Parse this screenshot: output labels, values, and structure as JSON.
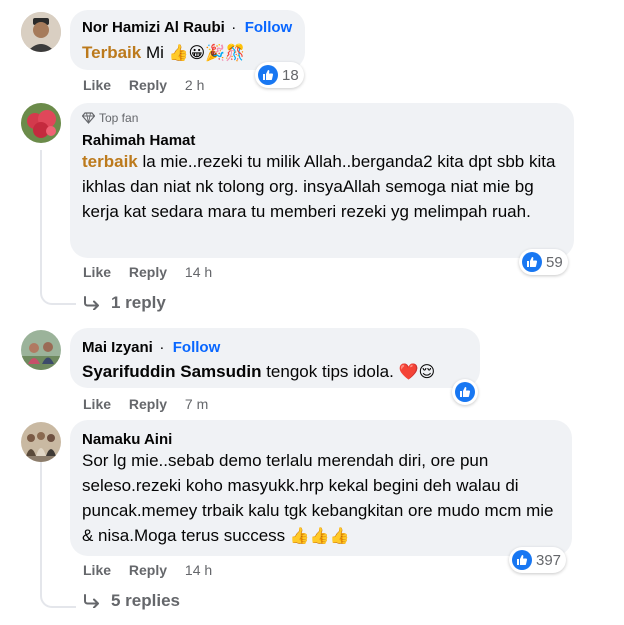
{
  "colors": {
    "follow": "#0866ff",
    "mention_gold": "#bc7a1c",
    "bubble": "#f0f2f5",
    "meta": "#65676b",
    "like_blue": "#1877f2"
  },
  "actions": {
    "like": "Like",
    "reply": "Reply",
    "follow": "Follow"
  },
  "comments": [
    {
      "author": "Nor Hamizi Al Raubi",
      "mention": "Terbaik",
      "text": " Mi ",
      "emojis": [
        "👍",
        "😀",
        "🎉",
        "🎊"
      ],
      "time": "2 h",
      "reactions": "18"
    },
    {
      "badge": "Top fan",
      "author": "Rahimah Hamat",
      "mention": "terbaik",
      "text": " la mie..rezeki tu milik Allah..berganda2 kita dpt sbb kita ikhlas dan niat nk tolong org. insyaAllah semoga niat mie bg kerja kat sedara mara tu memberi rezeki yg melimpah ruah.",
      "time": "14 h",
      "reactions": "59",
      "replies": "1 reply"
    },
    {
      "author": "Mai Izyani",
      "mention": "Syarifuddin Samsudin",
      "text": " tengok tips idola. ",
      "emojis": [
        "❤️",
        "😌"
      ],
      "time": "7 m"
    },
    {
      "author": "Namaku Aini",
      "text": "Sor lg mie..sebab demo terlalu merendah diri, ore pun seleso.rezeki koho masyukk.hrp kekal begini deh walau di puncak.memey trbaik kalu tgk kebangkitan ore mudo mcm mie & nisa.Moga terus success ",
      "emojis": [
        "👍",
        "👍",
        "👍"
      ],
      "time": "14 h",
      "reactions": "397",
      "replies": "5 replies"
    }
  ]
}
